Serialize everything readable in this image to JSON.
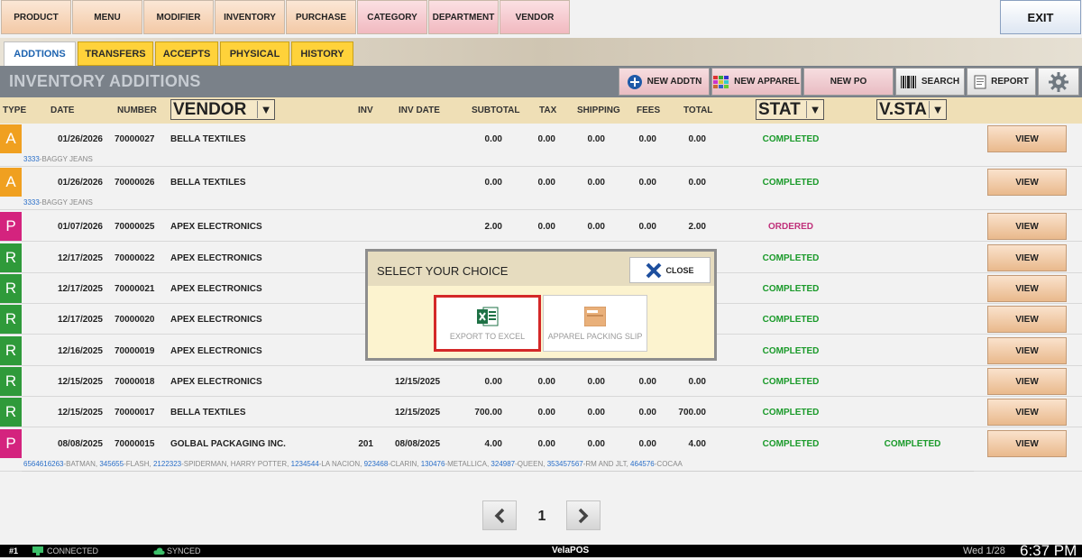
{
  "nav": {
    "items": [
      {
        "label": "PRODUCT",
        "style": "peach"
      },
      {
        "label": "MENU",
        "style": "peach"
      },
      {
        "label": "MODIFIER",
        "style": "peach"
      },
      {
        "label": "INVENTORY",
        "style": "peach"
      },
      {
        "label": "PURCHASE",
        "style": "peach"
      },
      {
        "label": "CATEGORY",
        "style": "pink"
      },
      {
        "label": "DEPARTMENT",
        "style": "pink"
      },
      {
        "label": "VENDOR",
        "style": "pink"
      }
    ],
    "exit": "EXIT"
  },
  "tabs": [
    {
      "label": "ADDTIONS",
      "active": true
    },
    {
      "label": "TRANSFERS",
      "active": false
    },
    {
      "label": "ACCEPTS",
      "active": false
    },
    {
      "label": "PHYSICAL",
      "active": false
    },
    {
      "label": "HISTORY",
      "active": false
    }
  ],
  "page_title": "INVENTORY ADDITIONS",
  "toolbar": {
    "new_addtn": "NEW ADDTN",
    "new_apparel": "NEW APPAREL",
    "new_po": "NEW PO",
    "search": "SEARCH",
    "report": "REPORT"
  },
  "columns": {
    "type": "TYPE",
    "date": "DATE",
    "number": "NUMBER",
    "vendor": "VENDOR",
    "inv": "INV",
    "inv_date": "INV DATE",
    "subtotal": "SUBTOTAL",
    "tax": "TAX",
    "shipping": "SHIPPING",
    "fees": "FEES",
    "total": "TOTAL",
    "stat": "STAT",
    "vstat": "V.STA"
  },
  "rows": [
    {
      "type": "A",
      "date": "01/26/2026",
      "number": "70000027",
      "vendor": "BELLA TEXTILES",
      "inv": "",
      "inv_date": "",
      "subtotal": "0.00",
      "tax": "0.00",
      "shipping": "0.00",
      "fees": "0.00",
      "total": "0.00",
      "status": "COMPLETED",
      "vstatus": "",
      "view": "VIEW",
      "sub": [
        {
          "code": "3333",
          "name": "-BAGGY JEANS"
        }
      ]
    },
    {
      "type": "A",
      "date": "01/26/2026",
      "number": "70000026",
      "vendor": "BELLA TEXTILES",
      "inv": "",
      "inv_date": "",
      "subtotal": "0.00",
      "tax": "0.00",
      "shipping": "0.00",
      "fees": "0.00",
      "total": "0.00",
      "status": "COMPLETED",
      "vstatus": "",
      "view": "VIEW",
      "sub": [
        {
          "code": "3333",
          "name": "-BAGGY JEANS"
        }
      ]
    },
    {
      "type": "P",
      "date": "01/07/2026",
      "number": "70000025",
      "vendor": "APEX ELECTRONICS",
      "inv": "",
      "inv_date": "",
      "subtotal": "2.00",
      "tax": "0.00",
      "shipping": "0.00",
      "fees": "0.00",
      "total": "2.00",
      "status": "ORDERED",
      "vstatus": "",
      "view": "VIEW",
      "sub": []
    },
    {
      "type": "R",
      "date": "12/17/2025",
      "number": "70000022",
      "vendor": "APEX ELECTRONICS",
      "inv": "",
      "inv_date": "",
      "subtotal": "",
      "tax": "",
      "shipping": "",
      "fees": "",
      "total": "",
      "status": "COMPLETED",
      "vstatus": "",
      "view": "VIEW",
      "sub": []
    },
    {
      "type": "R",
      "date": "12/17/2025",
      "number": "70000021",
      "vendor": "APEX ELECTRONICS",
      "inv": "",
      "inv_date": "",
      "subtotal": "",
      "tax": "",
      "shipping": "",
      "fees": "",
      "total": "",
      "status": "COMPLETED",
      "vstatus": "",
      "view": "VIEW",
      "sub": []
    },
    {
      "type": "R",
      "date": "12/17/2025",
      "number": "70000020",
      "vendor": "APEX ELECTRONICS",
      "inv": "",
      "inv_date": "",
      "subtotal": "",
      "tax": "",
      "shipping": "",
      "fees": "",
      "total": "",
      "status": "COMPLETED",
      "vstatus": "",
      "view": "VIEW",
      "sub": []
    },
    {
      "type": "R",
      "date": "12/16/2025",
      "number": "70000019",
      "vendor": "APEX ELECTRONICS",
      "inv": "",
      "inv_date": "",
      "subtotal": "",
      "tax": "",
      "shipping": "",
      "fees": "",
      "total": "",
      "status": "COMPLETED",
      "vstatus": "",
      "view": "VIEW",
      "sub": []
    },
    {
      "type": "R",
      "date": "12/15/2025",
      "number": "70000018",
      "vendor": "APEX ELECTRONICS",
      "inv": "",
      "inv_date": "12/15/2025",
      "subtotal": "0.00",
      "tax": "0.00",
      "shipping": "0.00",
      "fees": "0.00",
      "total": "0.00",
      "status": "COMPLETED",
      "vstatus": "",
      "view": "VIEW",
      "sub": []
    },
    {
      "type": "R",
      "date": "12/15/2025",
      "number": "70000017",
      "vendor": "BELLA TEXTILES",
      "inv": "",
      "inv_date": "12/15/2025",
      "subtotal": "700.00",
      "tax": "0.00",
      "shipping": "0.00",
      "fees": "0.00",
      "total": "700.00",
      "status": "COMPLETED",
      "vstatus": "",
      "view": "VIEW",
      "sub": []
    },
    {
      "type": "P",
      "date": "08/08/2025",
      "number": "70000015",
      "vendor": "GOLBAL PACKAGING INC.",
      "inv": "201",
      "inv_date": "08/08/2025",
      "subtotal": "4.00",
      "tax": "0.00",
      "shipping": "0.00",
      "fees": "0.00",
      "total": "4.00",
      "status": "COMPLETED",
      "vstatus": "COMPLETED",
      "view": "VIEW",
      "sub": [
        {
          "code": "6564616263",
          "name": "-BATMAN, "
        },
        {
          "code": "345655",
          "name": "-FLASH, "
        },
        {
          "code": "2122323",
          "name": "-SPIDERMAN, HARRY POTTER, "
        },
        {
          "code": "1234544",
          "name": "-LA NACION, "
        },
        {
          "code": "923468",
          "name": "-CLARIN, "
        },
        {
          "code": "130476",
          "name": "-METALLICA, "
        },
        {
          "code": "324987",
          "name": "-QUEEN, "
        },
        {
          "code": "353457567",
          "name": "-RM AND JLT, "
        },
        {
          "code": "464576",
          "name": "-COCAA"
        }
      ]
    }
  ],
  "badge_colors": {
    "A": "#f0a020",
    "P": "#d4237e",
    "R": "#2f9a3a"
  },
  "pagination": {
    "prev_icon": "chevron-left-icon",
    "page": "1",
    "next_icon": "chevron-right-icon"
  },
  "dialog": {
    "title": "SELECT YOUR CHOICE",
    "close": "CLOSE",
    "options": [
      {
        "label": "EXPORT TO EXCEL",
        "icon": "excel-icon",
        "selected": true
      },
      {
        "label": "APPAREL PACKING SLIP",
        "icon": "packing-slip-icon",
        "selected": false
      }
    ]
  },
  "statusbar": {
    "station": "#1",
    "connected": "CONNECTED",
    "synced": "SYNCED",
    "app": "VelaPOS",
    "date": "Wed 1/28",
    "time": "6:37 PM"
  }
}
